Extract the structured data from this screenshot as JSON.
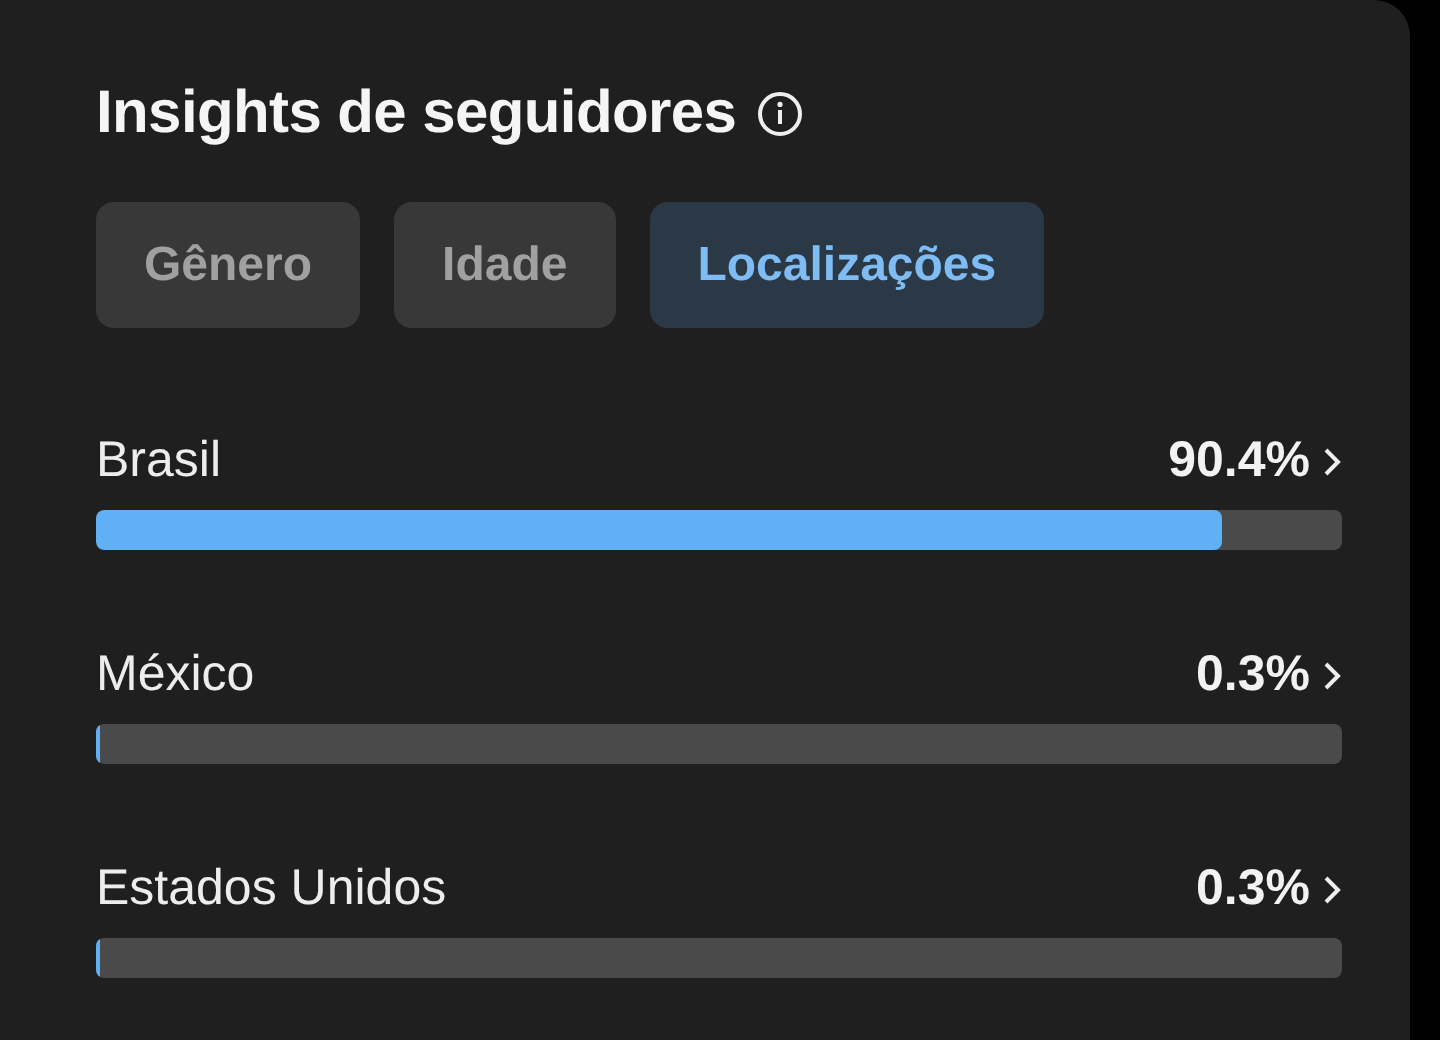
{
  "title": "Insights de seguidores",
  "tabs": [
    {
      "label": "Gênero",
      "selected": false
    },
    {
      "label": "Idade",
      "selected": false
    },
    {
      "label": "Localizações",
      "selected": true
    }
  ],
  "locations": [
    {
      "name": "Brasil",
      "reading": "90.4%",
      "level": 0.904
    },
    {
      "name": "México",
      "reading": "0.3%",
      "level": 0.003
    },
    {
      "name": "Estados Unidos",
      "reading": "0.3%",
      "level": 0.003
    }
  ]
}
